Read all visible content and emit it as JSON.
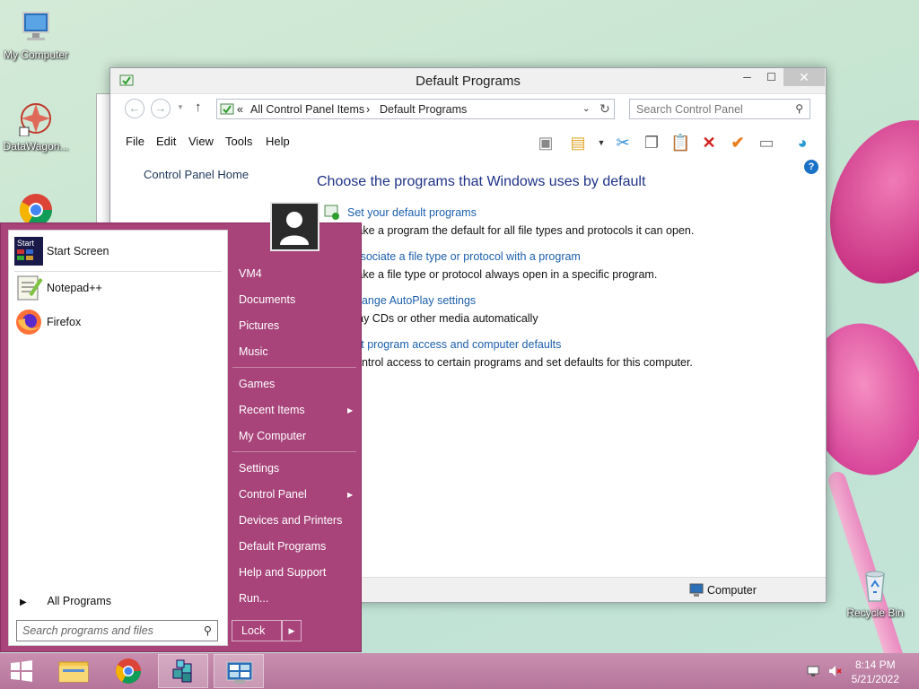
{
  "desktop": {
    "icons": [
      {
        "label": "My Computer"
      },
      {
        "label": "DataWagon..."
      },
      {
        "label": "Recycle Bin"
      }
    ]
  },
  "window": {
    "title": "Default Programs",
    "controls": {
      "minimize": "─",
      "maximize": "☐",
      "close": "✕"
    },
    "address": {
      "chevron": "«",
      "crumb1": "All Control Panel Items",
      "sep": "›",
      "crumb2": "Default Programs"
    },
    "search_placeholder": "Search Control Panel",
    "menu": [
      "File",
      "Edit",
      "View",
      "Tools",
      "Help"
    ],
    "sidebar_link": "Control Panel Home",
    "heading": "Choose the programs that Windows uses by default",
    "options": [
      {
        "link": "Set your default programs",
        "desc": "Make a program the default for all file types and protocols it can open."
      },
      {
        "link": "Associate a file type or protocol with a program",
        "desc": "Make a file type or protocol always open in a specific program."
      },
      {
        "link": "Change AutoPlay settings",
        "desc": "Play CDs or other media automatically"
      },
      {
        "link": "Set program access and computer defaults",
        "desc": "Control access to certain programs and set defaults for this computer."
      }
    ],
    "status": "Computer"
  },
  "start_menu": {
    "pinned": [
      {
        "label": "Start Screen",
        "icon": "start-screen-icon",
        "icon_text": "Start"
      },
      {
        "label": "Notepad++",
        "icon": "notepadpp-icon"
      },
      {
        "label": "Firefox",
        "icon": "firefox-icon"
      }
    ],
    "all_programs": "All Programs",
    "search_placeholder": "Search programs and files",
    "right": {
      "user": "VM4",
      "documents": "Documents",
      "pictures": "Pictures",
      "music": "Music",
      "games": "Games",
      "recent": "Recent Items",
      "computer": "My Computer",
      "settings": "Settings",
      "control_panel": "Control Panel",
      "devices": "Devices and Printers",
      "default_programs": "Default Programs",
      "help": "Help and Support",
      "run": "Run..."
    },
    "lock": "Lock"
  },
  "taskbar": {
    "time": "8:14 PM",
    "date": "5/21/2022"
  },
  "colors": {
    "start_menu_bg": "#a8447a",
    "link": "#1b5fad",
    "heading": "#1e3287"
  }
}
